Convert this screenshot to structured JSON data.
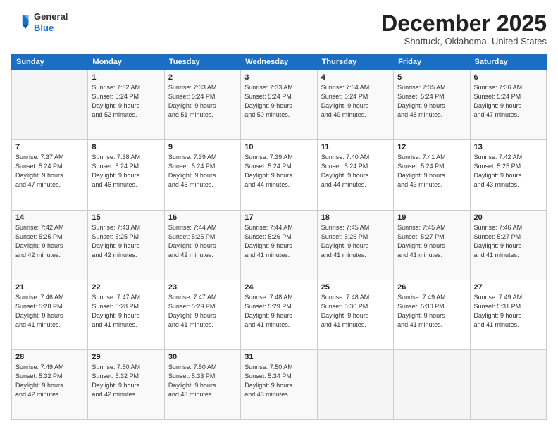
{
  "logo": {
    "line1": "General",
    "line2": "Blue"
  },
  "header": {
    "month": "December 2025",
    "location": "Shattuck, Oklahoma, United States"
  },
  "days_of_week": [
    "Sunday",
    "Monday",
    "Tuesday",
    "Wednesday",
    "Thursday",
    "Friday",
    "Saturday"
  ],
  "weeks": [
    [
      {
        "day": "",
        "info": ""
      },
      {
        "day": "1",
        "info": "Sunrise: 7:32 AM\nSunset: 5:24 PM\nDaylight: 9 hours\nand 52 minutes."
      },
      {
        "day": "2",
        "info": "Sunrise: 7:33 AM\nSunset: 5:24 PM\nDaylight: 9 hours\nand 51 minutes."
      },
      {
        "day": "3",
        "info": "Sunrise: 7:33 AM\nSunset: 5:24 PM\nDaylight: 9 hours\nand 50 minutes."
      },
      {
        "day": "4",
        "info": "Sunrise: 7:34 AM\nSunset: 5:24 PM\nDaylight: 9 hours\nand 49 minutes."
      },
      {
        "day": "5",
        "info": "Sunrise: 7:35 AM\nSunset: 5:24 PM\nDaylight: 9 hours\nand 48 minutes."
      },
      {
        "day": "6",
        "info": "Sunrise: 7:36 AM\nSunset: 5:24 PM\nDaylight: 9 hours\nand 47 minutes."
      }
    ],
    [
      {
        "day": "7",
        "info": "Sunrise: 7:37 AM\nSunset: 5:24 PM\nDaylight: 9 hours\nand 47 minutes."
      },
      {
        "day": "8",
        "info": "Sunrise: 7:38 AM\nSunset: 5:24 PM\nDaylight: 9 hours\nand 46 minutes."
      },
      {
        "day": "9",
        "info": "Sunrise: 7:39 AM\nSunset: 5:24 PM\nDaylight: 9 hours\nand 45 minutes."
      },
      {
        "day": "10",
        "info": "Sunrise: 7:39 AM\nSunset: 5:24 PM\nDaylight: 9 hours\nand 44 minutes."
      },
      {
        "day": "11",
        "info": "Sunrise: 7:40 AM\nSunset: 5:24 PM\nDaylight: 9 hours\nand 44 minutes."
      },
      {
        "day": "12",
        "info": "Sunrise: 7:41 AM\nSunset: 5:24 PM\nDaylight: 9 hours\nand 43 minutes."
      },
      {
        "day": "13",
        "info": "Sunrise: 7:42 AM\nSunset: 5:25 PM\nDaylight: 9 hours\nand 43 minutes."
      }
    ],
    [
      {
        "day": "14",
        "info": "Sunrise: 7:42 AM\nSunset: 5:25 PM\nDaylight: 9 hours\nand 42 minutes."
      },
      {
        "day": "15",
        "info": "Sunrise: 7:43 AM\nSunset: 5:25 PM\nDaylight: 9 hours\nand 42 minutes."
      },
      {
        "day": "16",
        "info": "Sunrise: 7:44 AM\nSunset: 5:25 PM\nDaylight: 9 hours\nand 42 minutes."
      },
      {
        "day": "17",
        "info": "Sunrise: 7:44 AM\nSunset: 5:26 PM\nDaylight: 9 hours\nand 41 minutes."
      },
      {
        "day": "18",
        "info": "Sunrise: 7:45 AM\nSunset: 5:26 PM\nDaylight: 9 hours\nand 41 minutes."
      },
      {
        "day": "19",
        "info": "Sunrise: 7:45 AM\nSunset: 5:27 PM\nDaylight: 9 hours\nand 41 minutes."
      },
      {
        "day": "20",
        "info": "Sunrise: 7:46 AM\nSunset: 5:27 PM\nDaylight: 9 hours\nand 41 minutes."
      }
    ],
    [
      {
        "day": "21",
        "info": "Sunrise: 7:46 AM\nSunset: 5:28 PM\nDaylight: 9 hours\nand 41 minutes."
      },
      {
        "day": "22",
        "info": "Sunrise: 7:47 AM\nSunset: 5:28 PM\nDaylight: 9 hours\nand 41 minutes."
      },
      {
        "day": "23",
        "info": "Sunrise: 7:47 AM\nSunset: 5:29 PM\nDaylight: 9 hours\nand 41 minutes."
      },
      {
        "day": "24",
        "info": "Sunrise: 7:48 AM\nSunset: 5:29 PM\nDaylight: 9 hours\nand 41 minutes."
      },
      {
        "day": "25",
        "info": "Sunrise: 7:48 AM\nSunset: 5:30 PM\nDaylight: 9 hours\nand 41 minutes."
      },
      {
        "day": "26",
        "info": "Sunrise: 7:49 AM\nSunset: 5:30 PM\nDaylight: 9 hours\nand 41 minutes."
      },
      {
        "day": "27",
        "info": "Sunrise: 7:49 AM\nSunset: 5:31 PM\nDaylight: 9 hours\nand 41 minutes."
      }
    ],
    [
      {
        "day": "28",
        "info": "Sunrise: 7:49 AM\nSunset: 5:32 PM\nDaylight: 9 hours\nand 42 minutes."
      },
      {
        "day": "29",
        "info": "Sunrise: 7:50 AM\nSunset: 5:32 PM\nDaylight: 9 hours\nand 42 minutes."
      },
      {
        "day": "30",
        "info": "Sunrise: 7:50 AM\nSunset: 5:33 PM\nDaylight: 9 hours\nand 43 minutes."
      },
      {
        "day": "31",
        "info": "Sunrise: 7:50 AM\nSunset: 5:34 PM\nDaylight: 9 hours\nand 43 minutes."
      },
      {
        "day": "",
        "info": ""
      },
      {
        "day": "",
        "info": ""
      },
      {
        "day": "",
        "info": ""
      }
    ]
  ]
}
